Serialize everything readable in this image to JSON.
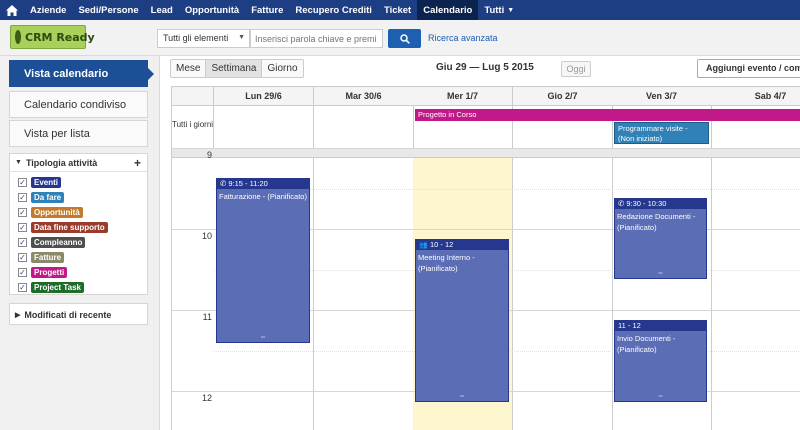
{
  "nav": {
    "items": [
      "Aziende",
      "Sedi/Persone",
      "Lead",
      "Opportunità",
      "Fatture",
      "Recupero Crediti",
      "Ticket",
      "Calendario",
      "Tutti"
    ],
    "active": "Calendario"
  },
  "header": {
    "logo_text": "CRM Ready",
    "filter_value": "Tutti gli elementi",
    "search_placeholder": "Inserisci parola chiave e premi invi",
    "advanced_search": "Ricerca avanzata"
  },
  "sidebar": {
    "buttons": [
      "Vista calendario",
      "Calendario condiviso",
      "Vista per lista"
    ],
    "activity_title": "Tipologia attività",
    "categories": [
      {
        "label": "Eventi",
        "color": "#26388e",
        "checked": true
      },
      {
        "label": "Da fare",
        "color": "#2f81b7",
        "checked": true
      },
      {
        "label": "Opportunità",
        "color": "#c07b2d",
        "checked": true
      },
      {
        "label": "Data fine supporto",
        "color": "#9a3b2c",
        "checked": true
      },
      {
        "label": "Compleanno",
        "color": "#4f4f4f",
        "checked": true
      },
      {
        "label": "Fatture",
        "color": "#8a8a6a",
        "checked": true
      },
      {
        "label": "Progetti",
        "color": "#c2198a",
        "checked": true
      },
      {
        "label": "Project Task",
        "color": "#1f6b2a",
        "checked": true
      }
    ],
    "recent_title": "Modificati di recente"
  },
  "toolbar": {
    "views": [
      "Mese",
      "Settimana",
      "Giorno"
    ],
    "active_view": "Settimana",
    "date_range": "Giu 29 — Lug 5 2015",
    "today": "Oggi",
    "add_event": "Aggiungi evento / compito"
  },
  "calendar": {
    "days": [
      "Lun 29/6",
      "Mar 30/6",
      "Mer 1/7",
      "Gio 2/7",
      "Ven 3/7",
      "Sab 4/7"
    ],
    "allday_label": "Tutti i giorni",
    "hours": [
      "9",
      "10",
      "11",
      "12"
    ],
    "allday_events": [
      {
        "title": "Progetto in Corso",
        "color": "#c2198a"
      },
      {
        "title": "Programmare visite - (Non iniziato)",
        "color": "#2f81b7"
      }
    ],
    "events": [
      {
        "time": "9:15 - 11:20",
        "title": "Fatturazione - (Pianificato)",
        "icon": "phone-icon"
      },
      {
        "time": "10 - 12",
        "title": "Meeting Interno - (Pianificato)",
        "icon": "people-icon"
      },
      {
        "time": "9:30 - 10:30",
        "title": "Redazione Documenti - (Pianificato)",
        "icon": "phone-icon"
      },
      {
        "time": "11 - 12",
        "title": "Invio Documenti - (Pianificato)",
        "icon": ""
      }
    ]
  }
}
